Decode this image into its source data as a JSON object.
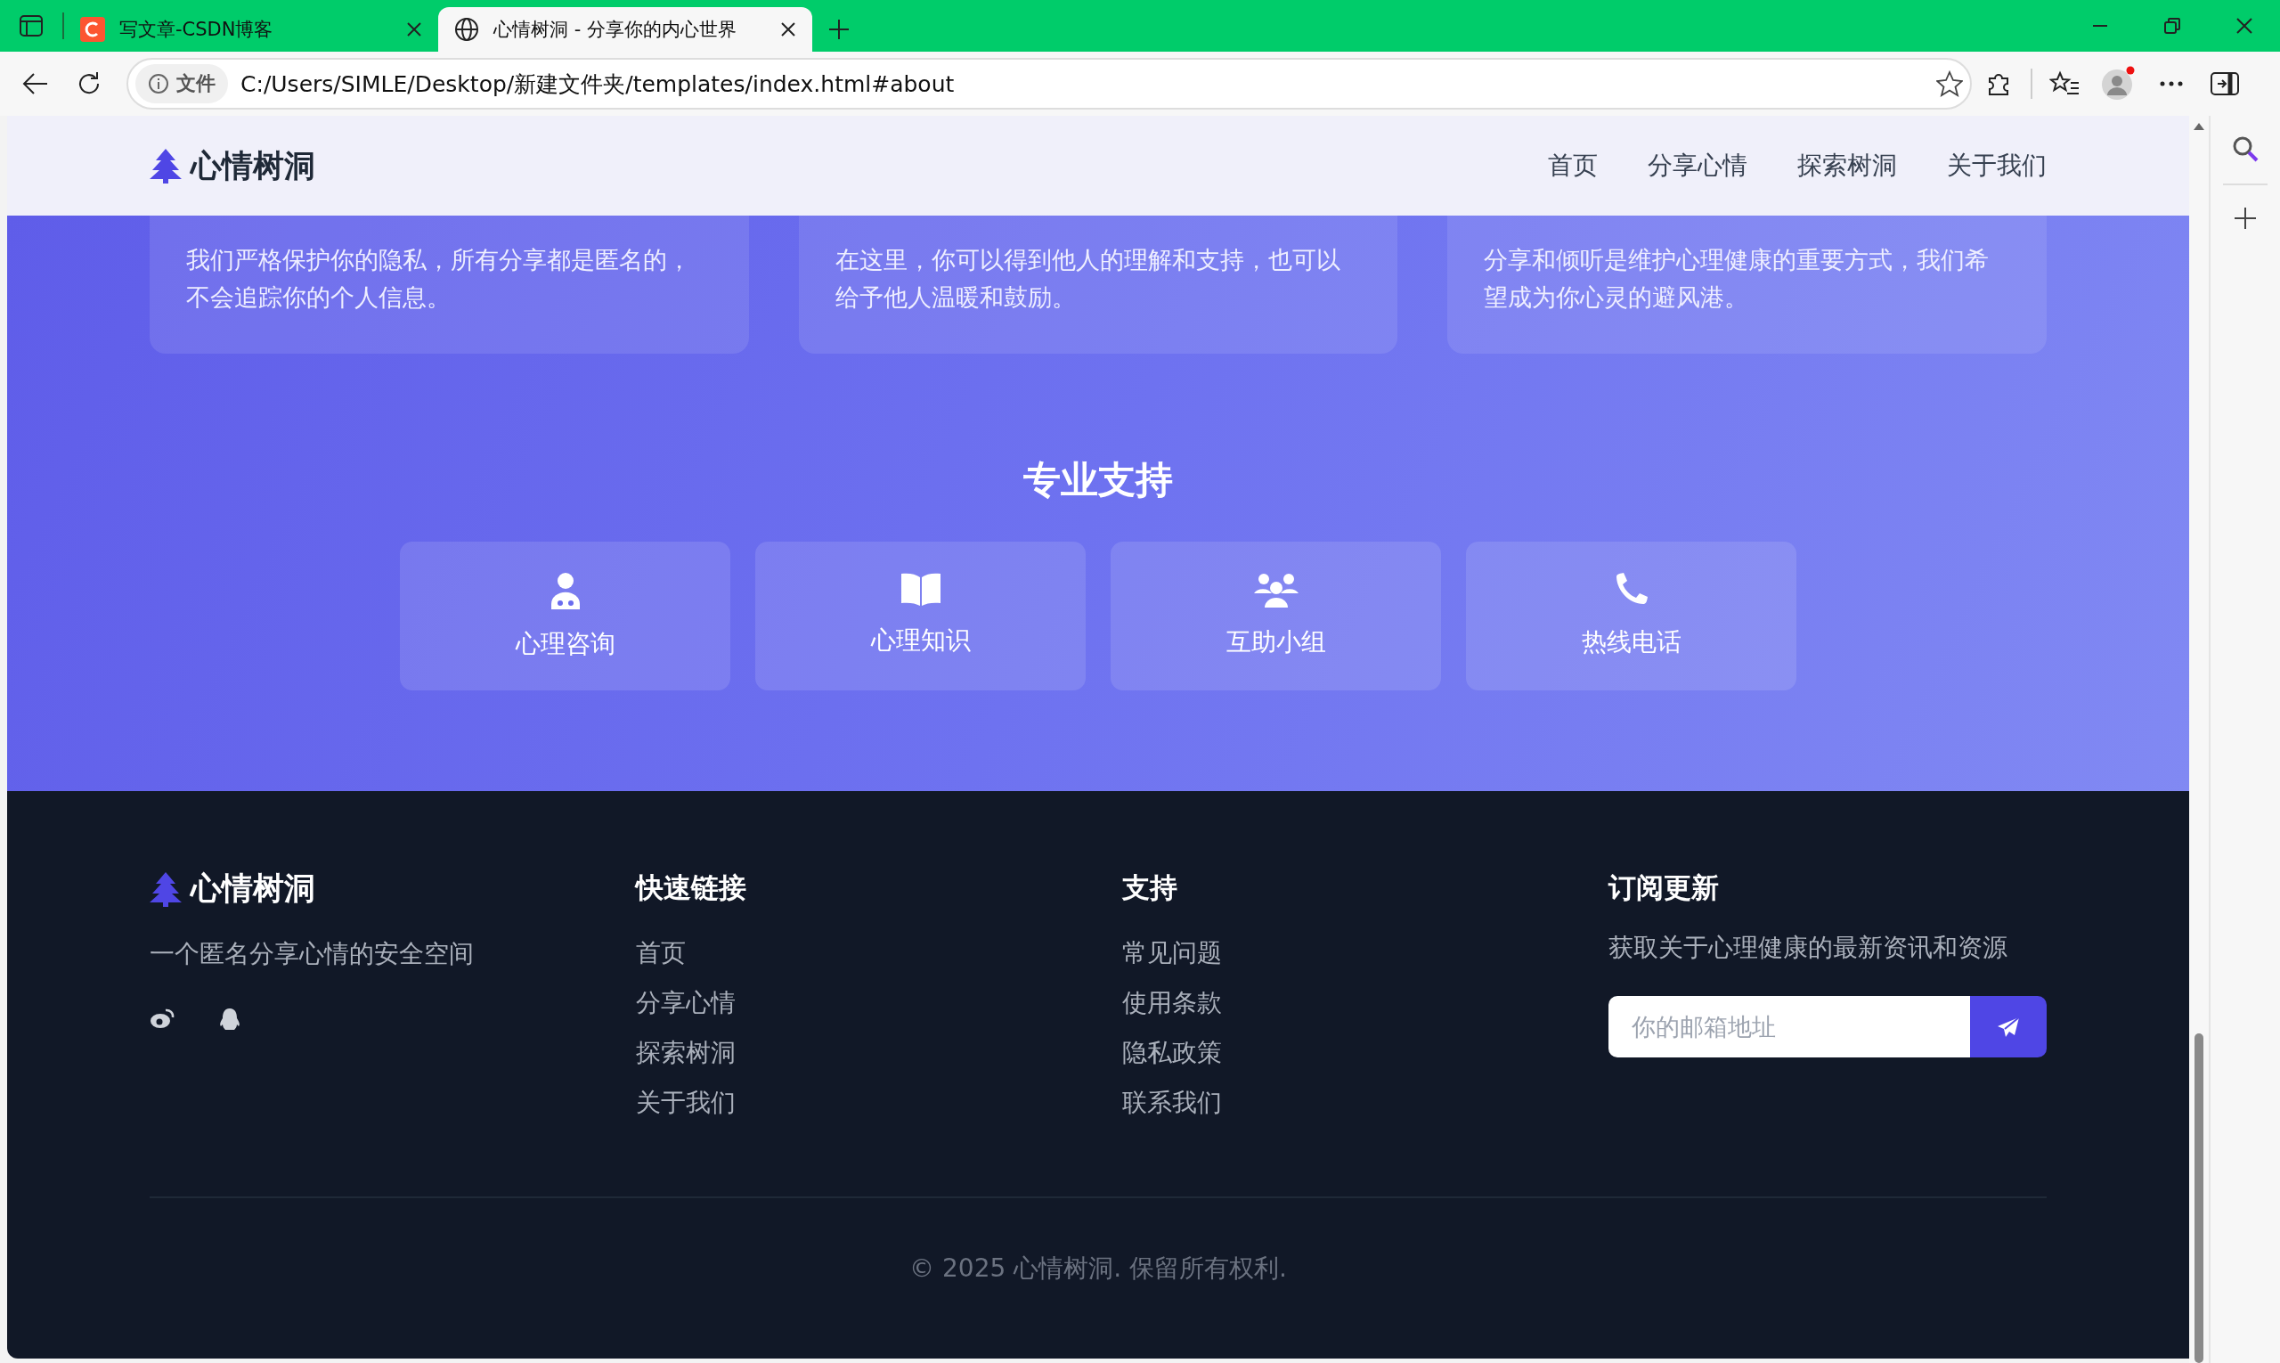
{
  "browser": {
    "tabs": [
      {
        "title": "写文章-CSDN博客",
        "kind": "c-logo",
        "selected": false
      },
      {
        "title": "心情树洞 - 分享你的内心世界",
        "kind": "globe",
        "selected": true
      }
    ],
    "address": {
      "chip": "文件",
      "url": "C:/Users/SIMLE/Desktop/新建文件夹/templates/index.html#about"
    }
  },
  "nav": {
    "brand": "心情树洞",
    "links": [
      "首页",
      "分享心情",
      "探索树洞",
      "关于我们"
    ]
  },
  "values": [
    {
      "text": "我们严格保护你的隐私，所有分享都是匿名的，不会追踪你的个人信息。"
    },
    {
      "text": "在这里，你可以得到他人的理解和支持，也可以给予他人温暖和鼓励。"
    },
    {
      "text": "分享和倾听是维护心理健康的重要方式，我们希望成为你心灵的避风港。"
    }
  ],
  "support": {
    "title": "专业支持",
    "items": [
      {
        "kind": "doctor",
        "label": "心理咨询"
      },
      {
        "kind": "book",
        "label": "心理知识"
      },
      {
        "kind": "group",
        "label": "互助小组"
      },
      {
        "kind": "phone",
        "label": "热线电话"
      }
    ]
  },
  "footer": {
    "brand": "心情树洞",
    "tagline": "一个匿名分享心情的安全空间",
    "socials": [
      {
        "kind": "weibo"
      },
      {
        "kind": "qq"
      }
    ],
    "columns": [
      {
        "title": "快速链接",
        "links": [
          "首页",
          "分享心情",
          "探索树洞",
          "关于我们"
        ]
      },
      {
        "title": "支持",
        "links": [
          "常见问题",
          "使用条款",
          "隐私政策",
          "联系我们"
        ]
      }
    ],
    "subscribe": {
      "title": "订阅更新",
      "text": "获取关于心理健康的最新资讯和资源",
      "placeholder": "你的邮箱地址"
    },
    "copyright": "© 2025 心情树洞. 保留所有权利."
  }
}
